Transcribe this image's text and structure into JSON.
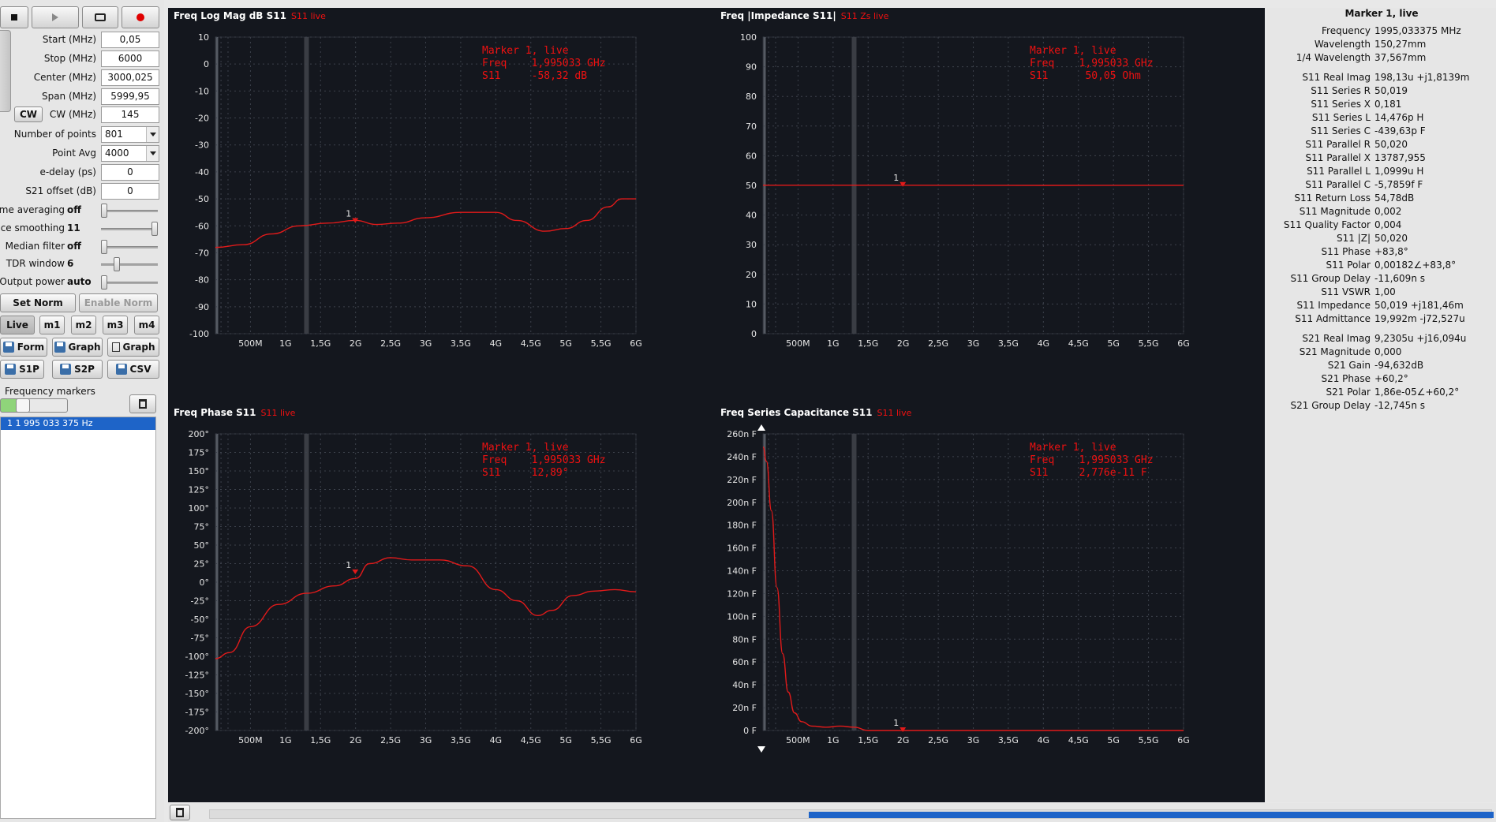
{
  "toolbar": {
    "stop_icon": "stop-icon",
    "play_icon": "play-icon",
    "scan_icon": "scan-icon",
    "record_icon": "record-icon",
    "record_color": "#e00000"
  },
  "params": [
    {
      "label": "Start (MHz)",
      "value": "0,05"
    },
    {
      "label": "Stop (MHz)",
      "value": "6000"
    },
    {
      "label": "Center (MHz)",
      "value": "3000,025"
    },
    {
      "label": "Span (MHz)",
      "value": "5999,95"
    },
    {
      "label": "CW (MHz)",
      "value": "145"
    }
  ],
  "cw_button": "CW",
  "points": {
    "label": "Number of points",
    "value": "801"
  },
  "avg": {
    "label": "Point Avg",
    "value": "4000"
  },
  "edelay": {
    "label": "e-delay (ps)",
    "value": "0"
  },
  "s21off": {
    "label": "S21 offset (dB)",
    "value": "0"
  },
  "sliders": [
    {
      "label": "ime averaging",
      "value": "off",
      "pos": 0
    },
    {
      "label": "ace smoothing",
      "value": "11",
      "pos": 1
    },
    {
      "label": "Median filter",
      "value": "off",
      "pos": 0
    },
    {
      "label": "TDR window",
      "value": "6",
      "pos": 0.25
    },
    {
      "label": "Output power",
      "value": "auto",
      "pos": 0
    }
  ],
  "norm": {
    "set": "Set Norm",
    "enable": "Enable Norm"
  },
  "mem": {
    "live": "Live",
    "m1": "m1",
    "m2": "m2",
    "m3": "m3",
    "m4": "m4"
  },
  "export1": {
    "form": "Form",
    "graph": "Graph",
    "graph2": "Graph"
  },
  "export2": {
    "s1p": "S1P",
    "s2p": "S2P",
    "csv": "CSV"
  },
  "markers": {
    "title": "Frequency markers",
    "item": "1  1 995 033 375 Hz"
  },
  "plots": {
    "tl": {
      "title": "Freq Log Mag dB S11",
      "sub": "S11 live",
      "m1": "Marker 1, live",
      "m2": "Freq    1,995033 GHz",
      "m3": "S11     -58,32 dB"
    },
    "tr": {
      "title": "Freq |Impedance S11|",
      "sub": "S11 Zs live",
      "m1": "Marker 1, live",
      "m2": "Freq    1,995033 GHz",
      "m3": "S11      50,05 Ohm"
    },
    "bl": {
      "title": "Freq Phase S11",
      "sub": "S11 live",
      "m1": "Marker 1, live",
      "m2": "Freq    1,995033 GHz",
      "m3": "S11     12,89°"
    },
    "br": {
      "title": "Freq Series Capacitance S11",
      "sub": "S11 live",
      "m1": "Marker 1, live",
      "m2": "Freq    1,995033 GHz",
      "m3": "S11     2,776e-11 F"
    }
  },
  "chart_data": [
    {
      "type": "line",
      "title": "Freq Log Mag dB S11",
      "x_ticks": [
        "500M",
        "1G",
        "1,5G",
        "2G",
        "2,5G",
        "3G",
        "3,5G",
        "4G",
        "4,5G",
        "5G",
        "5,5G",
        "6G"
      ],
      "y_ticks": [
        "10",
        "0",
        "-10",
        "-20",
        "-30",
        "-40",
        "-50",
        "-60",
        "-70",
        "-80",
        "-90",
        "-100"
      ],
      "xlim": [
        0,
        6
      ],
      "ylim": [
        -100,
        10
      ],
      "series": [
        {
          "name": "S11 live",
          "x": [
            0,
            0.4,
            0.8,
            1.2,
            1.6,
            2.0,
            2.3,
            2.6,
            3.0,
            3.5,
            4.0,
            4.3,
            4.7,
            5.0,
            5.3,
            5.6,
            5.8,
            6.0
          ],
          "values": [
            -68,
            -67,
            -63,
            -60,
            -59,
            -58,
            -59.5,
            -59,
            -57,
            -55,
            -55,
            -58,
            -62,
            -61,
            -58,
            -53,
            -50,
            -50
          ]
        }
      ],
      "marker": {
        "label": "1",
        "x": 1.995,
        "y": -58.32
      }
    },
    {
      "type": "line",
      "title": "Freq |Impedance S11|",
      "x_ticks": [
        "500M",
        "1G",
        "1,5G",
        "2G",
        "2,5G",
        "3G",
        "3,5G",
        "4G",
        "4,5G",
        "5G",
        "5,5G",
        "6G"
      ],
      "y_ticks": [
        "100",
        "90",
        "80",
        "70",
        "60",
        "50",
        "40",
        "30",
        "20",
        "10",
        "0"
      ],
      "xlim": [
        0,
        6
      ],
      "ylim": [
        0,
        100
      ],
      "series": [
        {
          "name": "S11 Zs live",
          "x": [
            0,
            2,
            4,
            6
          ],
          "values": [
            50.05,
            50.05,
            50.0,
            50.02
          ]
        }
      ],
      "marker": {
        "label": "1",
        "x": 1.995,
        "y": 50.05
      }
    },
    {
      "type": "line",
      "title": "Freq Phase S11",
      "x_ticks": [
        "500M",
        "1G",
        "1,5G",
        "2G",
        "2,5G",
        "3G",
        "3,5G",
        "4G",
        "4,5G",
        "5G",
        "5,5G",
        "6G"
      ],
      "y_ticks": [
        "200°",
        "175°",
        "150°",
        "125°",
        "100°",
        "75°",
        "50°",
        "25°",
        "0°",
        "-25°",
        "-50°",
        "-75°",
        "-100°",
        "-125°",
        "-150°",
        "-175°",
        "-200°"
      ],
      "xlim": [
        0,
        6
      ],
      "ylim": [
        -200,
        200
      ],
      "series": [
        {
          "name": "S11 live",
          "x": [
            0,
            0.2,
            0.5,
            0.9,
            1.3,
            1.7,
            2.0,
            2.2,
            2.5,
            2.8,
            3.2,
            3.6,
            4.0,
            4.3,
            4.6,
            4.8,
            5.1,
            5.4,
            5.7,
            6.0
          ],
          "values": [
            -103,
            -95,
            -60,
            -30,
            -15,
            -5,
            5,
            25,
            33,
            30,
            30,
            22,
            -10,
            -25,
            -45,
            -38,
            -18,
            -12,
            -10,
            -13
          ]
        }
      ],
      "marker": {
        "label": "1",
        "x": 1.995,
        "y": 12.89
      }
    },
    {
      "type": "line",
      "title": "Freq Series Capacitance S11",
      "x_ticks": [
        "500M",
        "1G",
        "1,5G",
        "2G",
        "2,5G",
        "3G",
        "3,5G",
        "4G",
        "4,5G",
        "5G",
        "5,5G",
        "6G"
      ],
      "y_ticks": [
        "260n F",
        "240n F",
        "220n F",
        "200n F",
        "180n F",
        "160n F",
        "140n F",
        "120n F",
        "100n F",
        "80n F",
        "60n F",
        "40n F",
        "20n F",
        "0 F"
      ],
      "xlim": [
        0,
        6
      ],
      "ylim": [
        0,
        270
      ],
      "series": [
        {
          "name": "S11 live",
          "x": [
            0,
            0.05,
            0.12,
            0.2,
            0.28,
            0.36,
            0.45,
            0.55,
            0.7,
            0.9,
            1.1,
            1.3,
            1.5,
            2.0,
            3.0,
            4.0,
            5.0,
            6.0
          ],
          "values": [
            258,
            245,
            200,
            130,
            70,
            35,
            16,
            8,
            4,
            3,
            4,
            3,
            0,
            0,
            0,
            0,
            0,
            0
          ]
        }
      ],
      "marker": {
        "label": "1",
        "x": 1.995,
        "y": 0.03
      }
    }
  ],
  "info": {
    "title": "Marker 1, live",
    "group1": [
      {
        "label": "Frequency",
        "value": "1995,033375 MHz"
      },
      {
        "label": "Wavelength",
        "value": "150,27mm"
      },
      {
        "label": "1/4 Wavelength",
        "value": "37,567mm"
      }
    ],
    "group2": [
      {
        "label": "S11 Real Imag",
        "value": "198,13u +j1,8139m"
      },
      {
        "label": "S11 Series R",
        "value": "50,019"
      },
      {
        "label": "S11 Series X",
        "value": "0,181"
      },
      {
        "label": "S11 Series L",
        "value": "14,476p H"
      },
      {
        "label": "S11 Series C",
        "value": "-439,63p F"
      },
      {
        "label": "S11 Parallel R",
        "value": "50,020"
      },
      {
        "label": "S11 Parallel X",
        "value": "13787,955"
      },
      {
        "label": "S11 Parallel L",
        "value": "1,0999u H"
      },
      {
        "label": "S11 Parallel C",
        "value": "-5,7859f F"
      },
      {
        "label": "S11 Return Loss",
        "value": "54,78dB"
      },
      {
        "label": "S11 Magnitude",
        "value": "0,002"
      },
      {
        "label": "S11 Quality Factor",
        "value": "0,004"
      },
      {
        "label": "S11 |Z|",
        "value": "50,020"
      },
      {
        "label": "S11 Phase",
        "value": "+83,8°"
      },
      {
        "label": "S11 Polar",
        "value": "0,00182∠+83,8°"
      },
      {
        "label": "S11 Group Delay",
        "value": "-11,609n s"
      },
      {
        "label": "S11 VSWR",
        "value": "1,00"
      },
      {
        "label": "S11 Impedance",
        "value": "50,019 +j181,46m"
      },
      {
        "label": "S11 Admittance",
        "value": "19,992m -j72,527u"
      }
    ],
    "group3": [
      {
        "label": "S21 Real Imag",
        "value": "9,2305u +j16,094u"
      },
      {
        "label": "S21 Magnitude",
        "value": "0,000"
      },
      {
        "label": "S21 Gain",
        "value": "-94,632dB"
      },
      {
        "label": "S21 Phase",
        "value": "+60,2°"
      },
      {
        "label": "S21 Polar",
        "value": "1,86e-05∠+60,2°"
      },
      {
        "label": "S21 Group Delay",
        "value": "-12,745n s"
      }
    ]
  },
  "colors": {
    "trace": "#e11a1a",
    "plot_bg": "#14171e",
    "grid": "#3c414b",
    "selection": "#1e64c8"
  }
}
